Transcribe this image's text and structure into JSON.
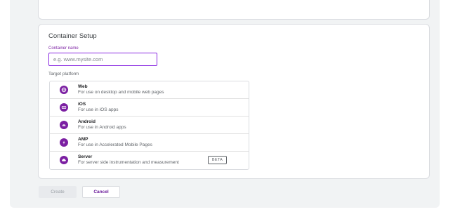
{
  "setup": {
    "title": "Container Setup",
    "name_label": "Container name",
    "name_placeholder": "e.g. www.mysite.com",
    "name_value": "",
    "platform_label": "Target platform"
  },
  "platforms": [
    {
      "name": "Web",
      "description": "For use on desktop and mobile web pages",
      "icon": "globe-icon"
    },
    {
      "name": "iOS",
      "description": "For use in iOS apps",
      "icon": "ios-icon"
    },
    {
      "name": "Android",
      "description": "For use in Android apps",
      "icon": "android-icon"
    },
    {
      "name": "AMP",
      "description": "For use in Accelerated Mobile Pages",
      "icon": "amp-bolt-icon"
    },
    {
      "name": "Server",
      "description": "For server side instrumentation and measurement",
      "icon": "cloud-icon",
      "badge": "BETA"
    }
  ],
  "actions": {
    "create_label": "Create",
    "cancel_label": "Cancel"
  },
  "colors": {
    "accent": "#7b1fa2",
    "focus_border": "#8a2be2",
    "card_border": "#dadce0",
    "page_background": "#f1f3f4"
  }
}
